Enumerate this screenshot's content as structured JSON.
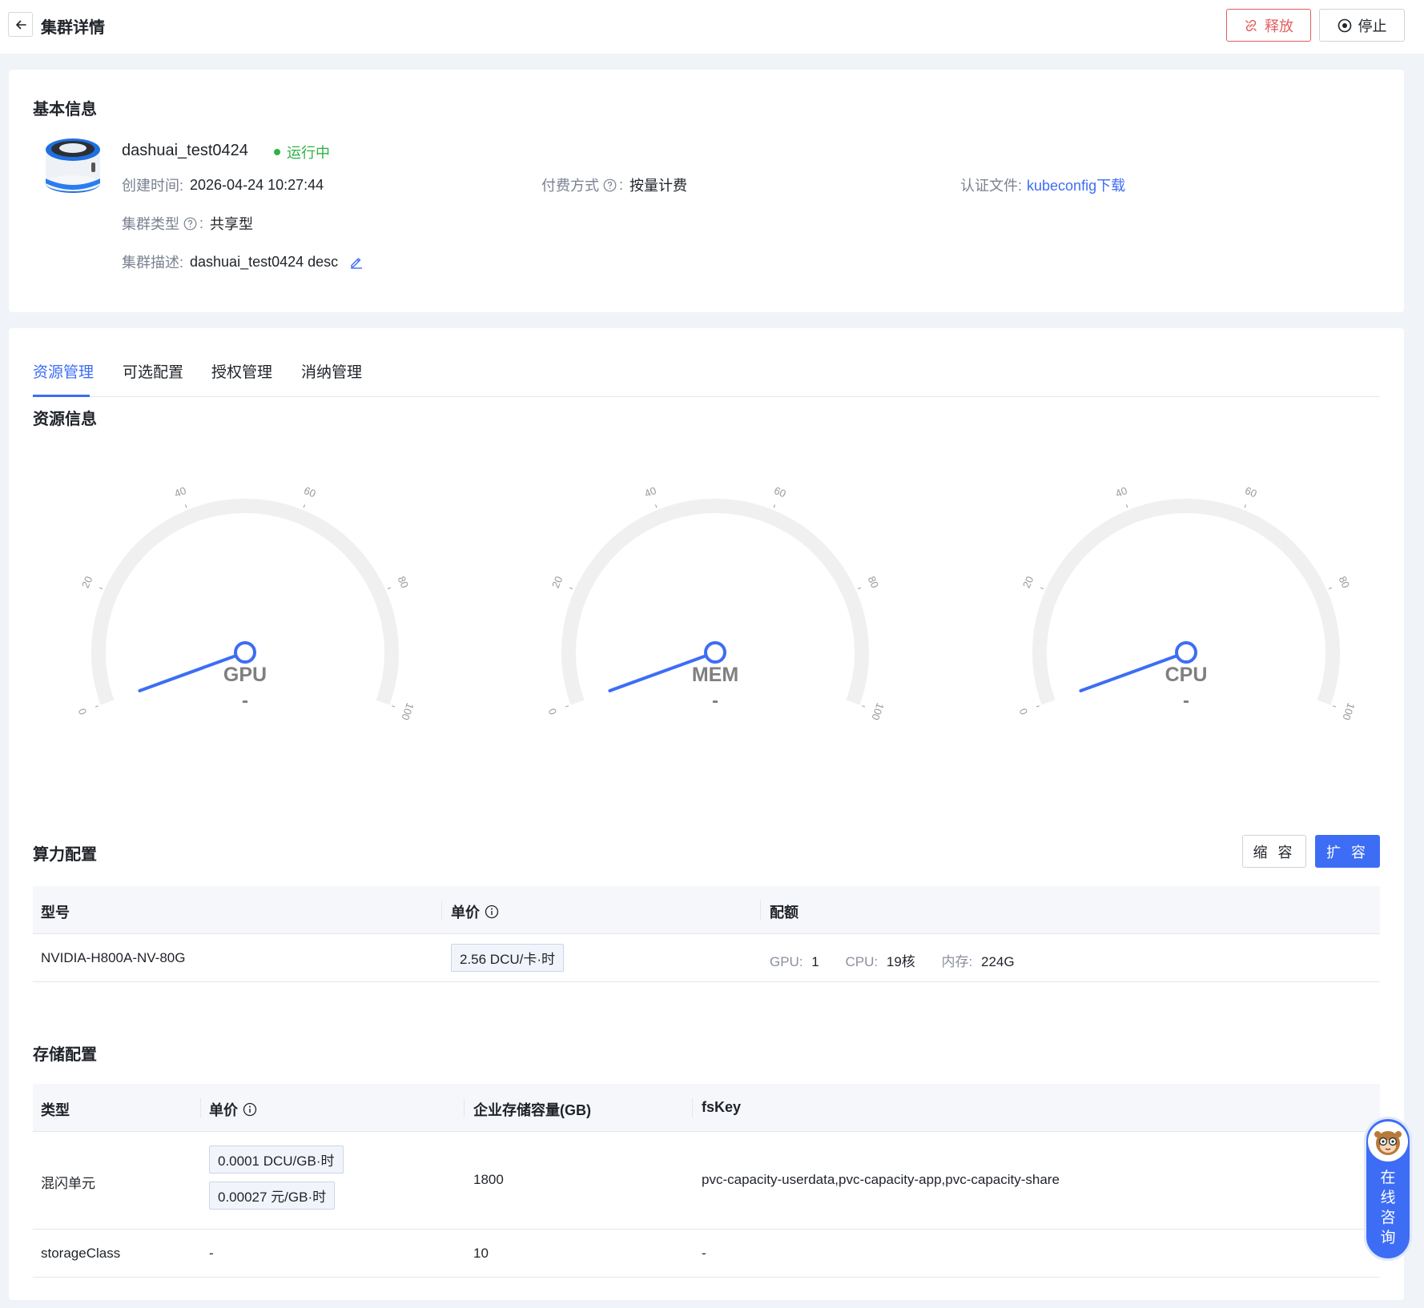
{
  "header": {
    "title": "集群详情",
    "release_label": "释放",
    "stop_label": "停止"
  },
  "basic": {
    "section_title": "基本信息",
    "cluster_name": "dashuai_test0424",
    "status": "运行中",
    "created_label": "创建时间:",
    "created_value": "2026-04-24 10:27:44",
    "billing_label": "付费方式",
    "billing_value": "按量计费",
    "auth_label": "认证文件:",
    "auth_link": "kubeconfig下载",
    "type_label": "集群类型",
    "type_value": "共享型",
    "desc_label": "集群描述:",
    "desc_value": "dashuai_test0424 desc",
    "colon": ":"
  },
  "tabs": [
    "资源管理",
    "可选配置",
    "授权管理",
    "消纳管理"
  ],
  "resource": {
    "section_title": "资源信息",
    "gauges": [
      {
        "name": "GPU",
        "value": "-",
        "pointer_level": 0.0
      },
      {
        "name": "MEM",
        "value": "-",
        "pointer_level": 0.0
      },
      {
        "name": "CPU",
        "value": "-",
        "pointer_level": 0.0
      }
    ],
    "gauge_ticks": [
      "0",
      "20",
      "40",
      "60",
      "80",
      "100"
    ]
  },
  "compute": {
    "section_title": "算力配置",
    "shrink_label": "缩 容",
    "expand_label": "扩 容",
    "headers": {
      "model": "型号",
      "price": "单价",
      "quota": "配额"
    },
    "rows": [
      {
        "model": "NVIDIA-H800A-NV-80G",
        "price": "2.56 DCU/卡·时",
        "gpu_label": "GPU:",
        "gpu_value": "1",
        "cpu_label": "CPU:",
        "cpu_value": "19核",
        "mem_label": "内存:",
        "mem_value": "224G"
      }
    ]
  },
  "storage": {
    "section_title": "存储配置",
    "headers": {
      "type": "类型",
      "price": "单价",
      "capacity": "企业存储容量(GB)",
      "fskey": "fsKey"
    },
    "rows": [
      {
        "type": "混闪单元",
        "price1": "0.0001 DCU/GB·时",
        "price2": "0.00027 元/GB·时",
        "capacity": "1800",
        "fskey": "pvc-capacity-userdata,pvc-capacity-app,pvc-capacity-share"
      },
      {
        "type": "storageClass",
        "price": "-",
        "capacity": "10",
        "fskey": "-"
      }
    ]
  },
  "chat": {
    "label": "在线咨询"
  },
  "colors": {
    "accent": "#3d6df5",
    "danger": "#e35d5d",
    "success": "#2fb344"
  }
}
